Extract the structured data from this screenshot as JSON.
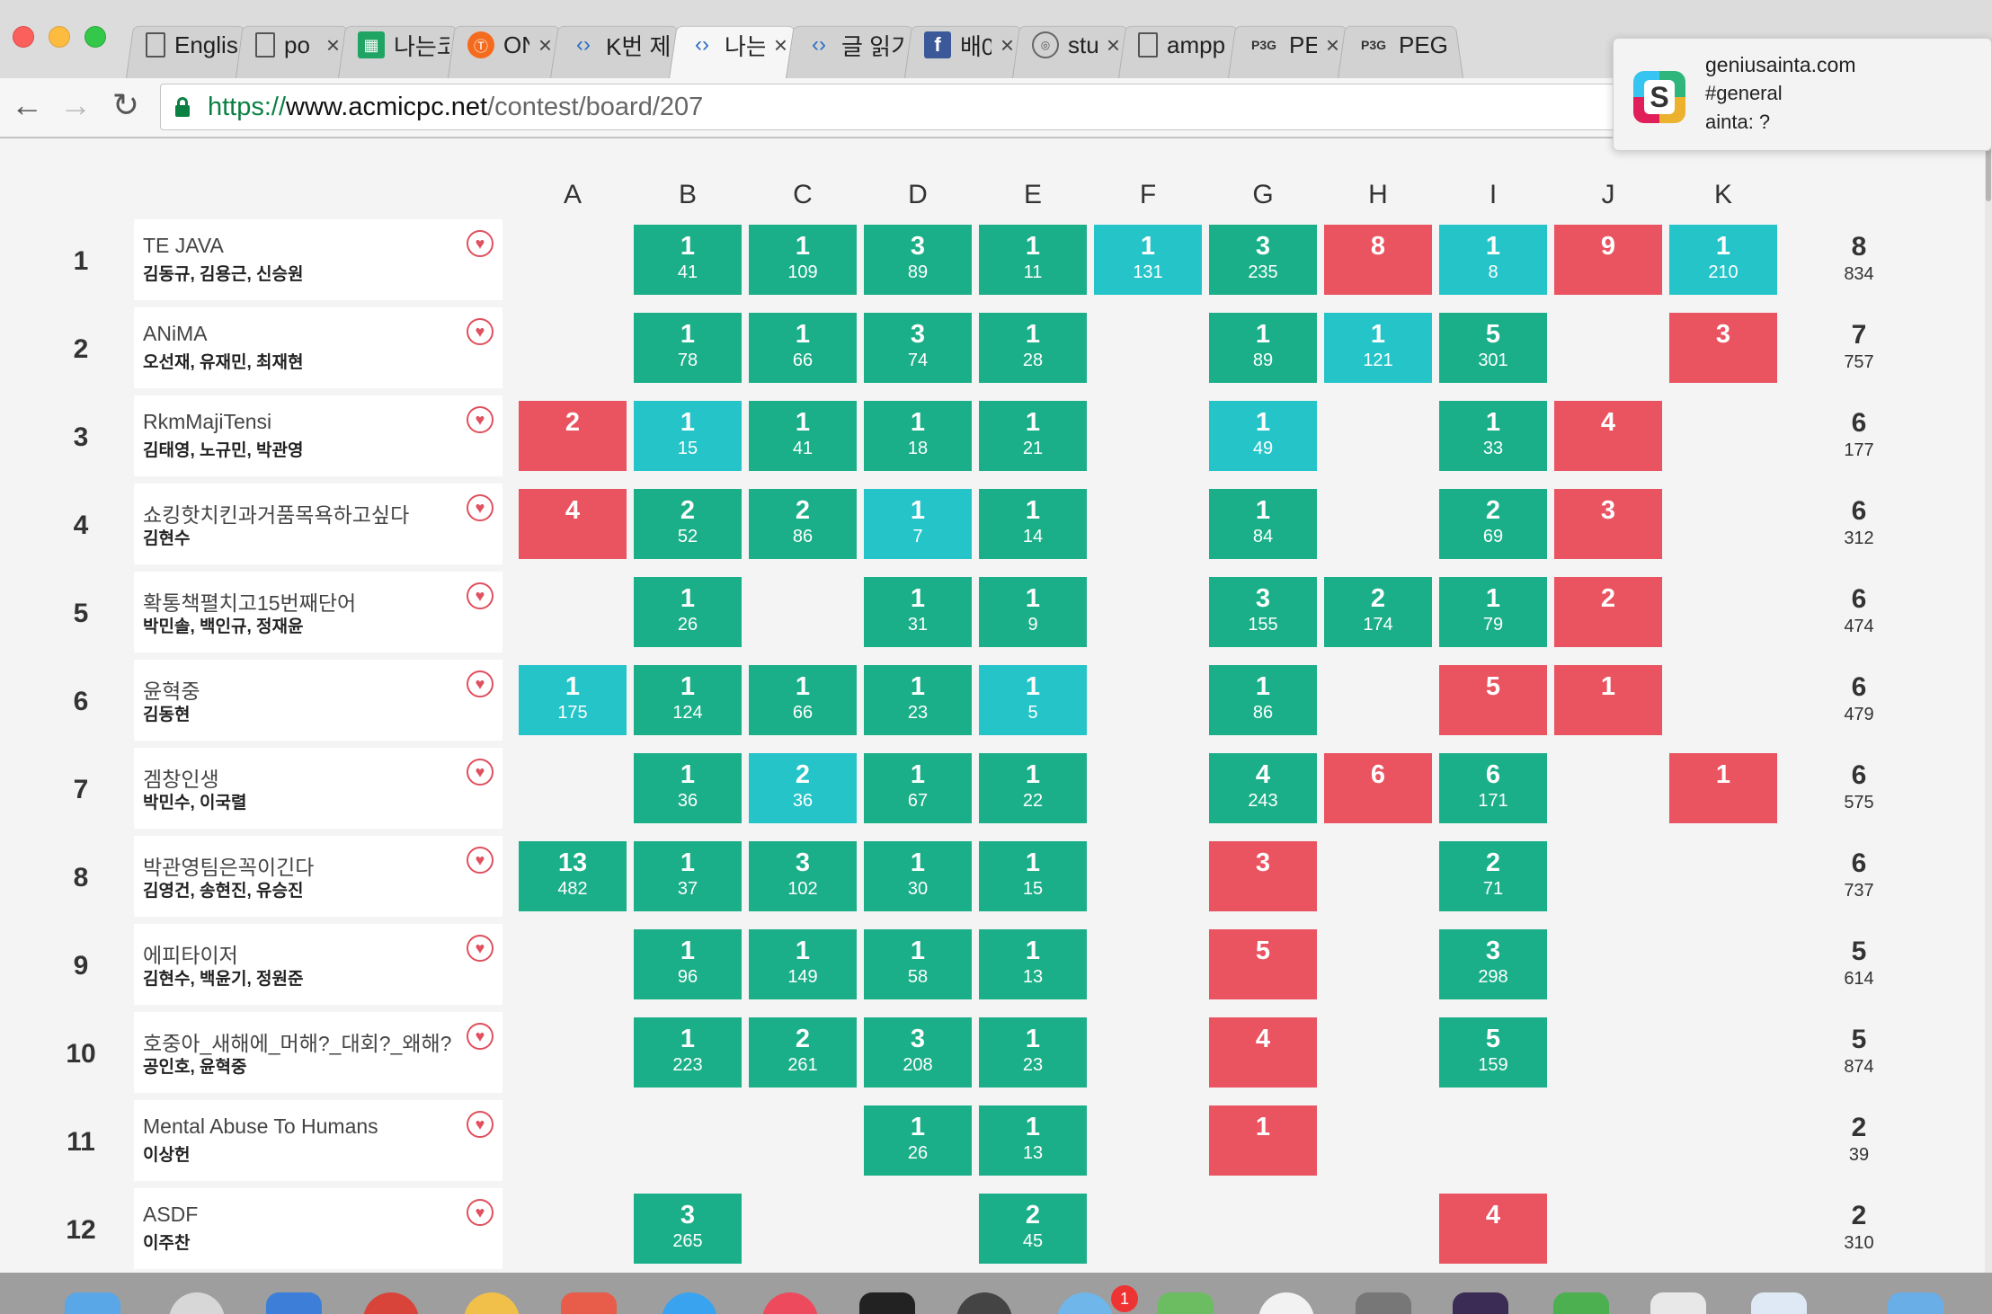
{
  "browser": {
    "tabs": [
      {
        "title": "Englis",
        "icon": "document-icon",
        "kind": "doc",
        "closable": false,
        "width": 140
      },
      {
        "title": "po",
        "icon": "document-icon",
        "kind": "doc",
        "closable": true,
        "width": 132
      },
      {
        "title": "나는코",
        "icon": "sheets-icon",
        "kind": "sheet",
        "closable": false,
        "width": 140
      },
      {
        "title": "ON",
        "icon": "orange-logo-icon",
        "kind": "orange",
        "closable": true,
        "width": 132
      },
      {
        "title": "K번 제",
        "icon": "code-icon",
        "kind": "code",
        "closable": false,
        "width": 150
      },
      {
        "title": "나는",
        "icon": "code-icon",
        "kind": "code",
        "closable": true,
        "active": true,
        "width": 148
      },
      {
        "title": "글 읽기",
        "icon": "code-icon",
        "kind": "code",
        "closable": false,
        "width": 150
      },
      {
        "title": "배0",
        "icon": "facebook-icon",
        "kind": "fb",
        "closable": true,
        "width": 138
      },
      {
        "title": "stu",
        "icon": "globe-icon",
        "kind": "circ",
        "closable": true,
        "width": 136
      },
      {
        "title": "ampp",
        "icon": "document-icon",
        "kind": "doc",
        "closable": false,
        "width": 140
      },
      {
        "title": "PE",
        "icon": "p3g-icon",
        "kind": "p3g",
        "closable": true,
        "width": 140
      },
      {
        "title": "PEG",
        "icon": "p3g-icon",
        "kind": "p3g",
        "closable": false,
        "width": 140
      }
    ],
    "url_scheme": "https://",
    "url_host": "www.acmicpc.net",
    "url_path": "/contest/board/207"
  },
  "notification": {
    "site": "geniusainta.com",
    "channel": "#general",
    "message": "ainta: ?"
  },
  "scoreboard": {
    "problems": [
      "A",
      "B",
      "C",
      "D",
      "E",
      "F",
      "G",
      "H",
      "I",
      "J",
      "K"
    ],
    "rows": [
      {
        "rank": "1",
        "team": "TE JAVA",
        "members": "김동규, 김용근, 신승원",
        "total_solved": "8",
        "total_time": "834",
        "cells": [
          null,
          [
            "s",
            "1",
            "41"
          ],
          [
            "s",
            "1",
            "109"
          ],
          [
            "s",
            "3",
            "89"
          ],
          [
            "s",
            "1",
            "11"
          ],
          [
            "f",
            "1",
            "131"
          ],
          [
            "s",
            "3",
            "235"
          ],
          [
            "x",
            "8",
            ""
          ],
          [
            "f",
            "1",
            "8"
          ],
          [
            "x",
            "9",
            ""
          ],
          [
            "f",
            "1",
            "210"
          ]
        ]
      },
      {
        "rank": "2",
        "team": "ANiMA",
        "members": "오선재, 유재민, 최재현",
        "total_solved": "7",
        "total_time": "757",
        "cells": [
          null,
          [
            "s",
            "1",
            "78"
          ],
          [
            "s",
            "1",
            "66"
          ],
          [
            "s",
            "3",
            "74"
          ],
          [
            "s",
            "1",
            "28"
          ],
          null,
          [
            "s",
            "1",
            "89"
          ],
          [
            "f",
            "1",
            "121"
          ],
          [
            "s",
            "5",
            "301"
          ],
          null,
          [
            "x",
            "3",
            ""
          ]
        ]
      },
      {
        "rank": "3",
        "team": "RkmMajiTensi",
        "members": "김태영, 노규민, 박관영",
        "total_solved": "6",
        "total_time": "177",
        "cells": [
          [
            "x",
            "2",
            ""
          ],
          [
            "f",
            "1",
            "15"
          ],
          [
            "s",
            "1",
            "41"
          ],
          [
            "s",
            "1",
            "18"
          ],
          [
            "s",
            "1",
            "21"
          ],
          null,
          [
            "f",
            "1",
            "49"
          ],
          null,
          [
            "s",
            "1",
            "33"
          ],
          [
            "x",
            "4",
            ""
          ],
          null
        ]
      },
      {
        "rank": "4",
        "team": "쇼킹핫치킨과거품목욕하고싶다",
        "members": "김현수",
        "total_solved": "6",
        "total_time": "312",
        "cells": [
          [
            "x",
            "4",
            ""
          ],
          [
            "s",
            "2",
            "52"
          ],
          [
            "s",
            "2",
            "86"
          ],
          [
            "f",
            "1",
            "7"
          ],
          [
            "s",
            "1",
            "14"
          ],
          null,
          [
            "s",
            "1",
            "84"
          ],
          null,
          [
            "s",
            "2",
            "69"
          ],
          [
            "x",
            "3",
            ""
          ],
          null
        ]
      },
      {
        "rank": "5",
        "team": "확통책펼치고15번째단어",
        "members": "박민솔, 백인규, 정재윤",
        "total_solved": "6",
        "total_time": "474",
        "cells": [
          null,
          [
            "s",
            "1",
            "26"
          ],
          null,
          [
            "s",
            "1",
            "31"
          ],
          [
            "s",
            "1",
            "9"
          ],
          null,
          [
            "s",
            "3",
            "155"
          ],
          [
            "s",
            "2",
            "174"
          ],
          [
            "s",
            "1",
            "79"
          ],
          [
            "x",
            "2",
            ""
          ],
          null
        ]
      },
      {
        "rank": "6",
        "team": "윤혁중",
        "members": "김동현",
        "total_solved": "6",
        "total_time": "479",
        "cells": [
          [
            "f",
            "1",
            "175"
          ],
          [
            "s",
            "1",
            "124"
          ],
          [
            "s",
            "1",
            "66"
          ],
          [
            "s",
            "1",
            "23"
          ],
          [
            "f",
            "1",
            "5"
          ],
          null,
          [
            "s",
            "1",
            "86"
          ],
          null,
          [
            "x",
            "5",
            ""
          ],
          [
            "x",
            "1",
            ""
          ],
          null
        ]
      },
      {
        "rank": "7",
        "team": "겜창인생",
        "members": "박민수, 이국렬",
        "total_solved": "6",
        "total_time": "575",
        "cells": [
          null,
          [
            "s",
            "1",
            "36"
          ],
          [
            "f",
            "2",
            "36"
          ],
          [
            "s",
            "1",
            "67"
          ],
          [
            "s",
            "1",
            "22"
          ],
          null,
          [
            "s",
            "4",
            "243"
          ],
          [
            "x",
            "6",
            ""
          ],
          [
            "s",
            "6",
            "171"
          ],
          null,
          [
            "x",
            "1",
            ""
          ]
        ]
      },
      {
        "rank": "8",
        "team": "박관영팀은꼭이긴다",
        "members": "김영건, 송현진, 유승진",
        "total_solved": "6",
        "total_time": "737",
        "cells": [
          [
            "s",
            "13",
            "482"
          ],
          [
            "s",
            "1",
            "37"
          ],
          [
            "s",
            "3",
            "102"
          ],
          [
            "s",
            "1",
            "30"
          ],
          [
            "s",
            "1",
            "15"
          ],
          null,
          [
            "x",
            "3",
            ""
          ],
          null,
          [
            "s",
            "2",
            "71"
          ],
          null,
          null
        ]
      },
      {
        "rank": "9",
        "team": "에피타이저",
        "members": "김현수, 백윤기, 정원준",
        "total_solved": "5",
        "total_time": "614",
        "cells": [
          null,
          [
            "s",
            "1",
            "96"
          ],
          [
            "s",
            "1",
            "149"
          ],
          [
            "s",
            "1",
            "58"
          ],
          [
            "s",
            "1",
            "13"
          ],
          null,
          [
            "x",
            "5",
            ""
          ],
          null,
          [
            "s",
            "3",
            "298"
          ],
          null,
          null
        ]
      },
      {
        "rank": "10",
        "team": "호중아_새해에_머해?_대회?_왜해?",
        "members": "공인호, 윤혁중",
        "total_solved": "5",
        "total_time": "874",
        "cells": [
          null,
          [
            "s",
            "1",
            "223"
          ],
          [
            "s",
            "2",
            "261"
          ],
          [
            "s",
            "3",
            "208"
          ],
          [
            "s",
            "1",
            "23"
          ],
          null,
          [
            "x",
            "4",
            ""
          ],
          null,
          [
            "s",
            "5",
            "159"
          ],
          null,
          null
        ]
      },
      {
        "rank": "11",
        "team": "Mental Abuse To Humans",
        "members": "이상헌",
        "total_solved": "2",
        "total_time": "39",
        "cells": [
          null,
          null,
          null,
          [
            "s",
            "1",
            "26"
          ],
          [
            "s",
            "1",
            "13"
          ],
          null,
          [
            "x",
            "1",
            ""
          ],
          null,
          null,
          null,
          null
        ]
      },
      {
        "rank": "12",
        "team": "ASDF",
        "members": "이주찬",
        "total_solved": "2",
        "total_time": "310",
        "cells": [
          null,
          [
            "s",
            "3",
            "265"
          ],
          null,
          null,
          [
            "s",
            "2",
            "45"
          ],
          null,
          null,
          null,
          [
            "x",
            "4",
            ""
          ],
          null,
          null
        ]
      }
    ]
  },
  "colors": {
    "solved": "#1aaf88",
    "first_solve": "#25c4c9",
    "failed": "#ea5360"
  }
}
